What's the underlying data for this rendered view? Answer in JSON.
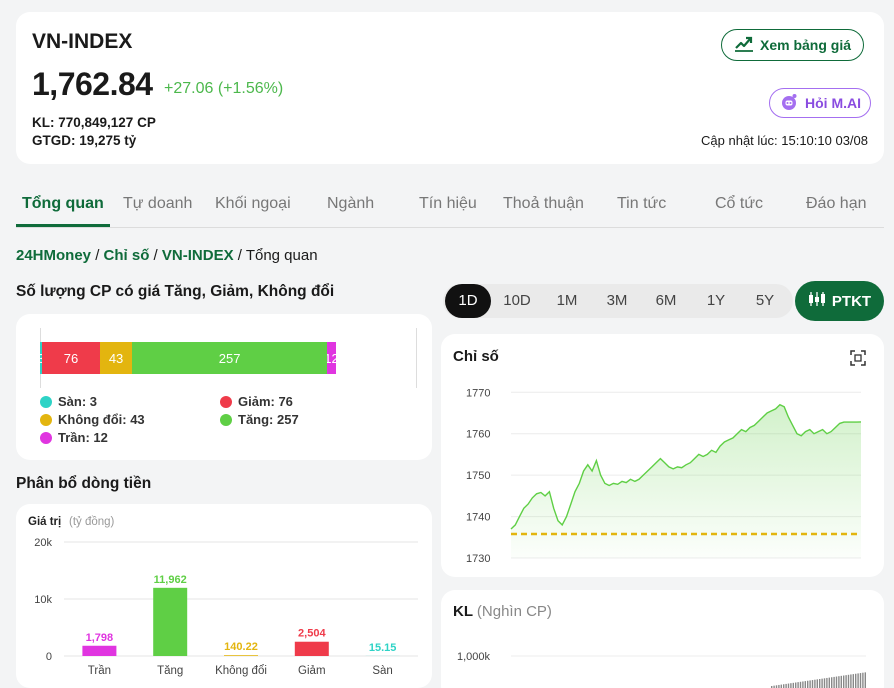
{
  "header": {
    "index_name": "VN-INDEX",
    "index_value": "1,762.84",
    "change": "+27.06 (+1.56%)",
    "volume_label": "KL: 770,849,127 CP",
    "value_label": "GTGD: 19,275 tỷ",
    "price_board_button": "Xem bảng giá",
    "ask_ai_button": "Hỏi M.AI",
    "update_text": "Cập nhật lúc: 15:10:10 03/08",
    "colors": {
      "up": "#4cb84c",
      "brand": "#0f6b3a",
      "ai": "#8a4ce0"
    }
  },
  "tabs": [
    "Tổng quan",
    "Tự doanh",
    "Khối ngoại",
    "Ngành",
    "Tín hiệu",
    "Thoả thuận",
    "Tin tức",
    "Cổ tức",
    "Đáo hạn"
  ],
  "breadcrumb": {
    "home": "24HMoney",
    "sep": " / ",
    "section": "Chỉ số",
    "index": "VN-INDEX",
    "current": "Tổng quan"
  },
  "breadth": {
    "title": "Số lượng CP có giá Tăng, Giảm, Không đổi",
    "segments": [
      {
        "key": "floor",
        "label": "3",
        "value": 3,
        "color": "#2ed3c6"
      },
      {
        "key": "down",
        "label": "76",
        "value": 76,
        "color": "#ef3b4a"
      },
      {
        "key": "flat",
        "label": "43",
        "value": 43,
        "color": "#e3b50f"
      },
      {
        "key": "up",
        "label": "257",
        "value": 257,
        "color": "#5fcf45"
      },
      {
        "key": "ceiling",
        "label": "12",
        "value": 12,
        "color": "#e035e0"
      }
    ],
    "legend": {
      "floor": "Sàn: 3",
      "down": "Giảm: 76",
      "flat": "Không đổi: 43",
      "up": "Tăng: 257",
      "ceiling": "Trần: 12"
    }
  },
  "money_flow": {
    "title": "Phân bổ dòng tiền",
    "chart_data": {
      "type": "bar",
      "ylabel": "Giá trị",
      "yunit": "(tỷ đồng)",
      "ylim": [
        0,
        20000
      ],
      "yticks": [
        "0",
        "10k",
        "20k"
      ],
      "yticks_values": [
        0,
        10000,
        20000
      ],
      "categories": [
        "Trần",
        "Tăng",
        "Không đổi",
        "Giảm",
        "Sàn"
      ],
      "values": [
        1798,
        11962,
        140.22,
        2504,
        15.15
      ],
      "value_labels": [
        "1,798",
        "11,962",
        "140.22",
        "2,504",
        "15.15"
      ],
      "colors": [
        "#e035e0",
        "#5fcf45",
        "#e3b50f",
        "#ef3b4a",
        "#2ed3c6"
      ]
    }
  },
  "ranges": [
    "1D",
    "10D",
    "1M",
    "3M",
    "6M",
    "1Y",
    "5Y"
  ],
  "active_range": "1D",
  "ptkt_button": "PTKT",
  "index_chart": {
    "title": "Chỉ số",
    "chart_data": {
      "type": "area",
      "ylim": [
        1730,
        1772
      ],
      "yticks": [
        1730,
        1740,
        1750,
        1760,
        1770
      ],
      "reference_value": 1735.78,
      "line_color": "#5fcf45",
      "ref_color": "#e3b50f",
      "values": [
        1737,
        1738,
        1740,
        1742,
        1743,
        1744.5,
        1745.5,
        1745.8,
        1745,
        1746,
        1742,
        1739,
        1738,
        1740,
        1743,
        1746,
        1748,
        1751,
        1752.5,
        1751,
        1753.5,
        1750,
        1748,
        1747.5,
        1748,
        1747.8,
        1748.5,
        1748.2,
        1749,
        1748.5,
        1749,
        1750,
        1751,
        1752,
        1753,
        1754,
        1753,
        1752,
        1751.5,
        1752,
        1751.8,
        1752.5,
        1753,
        1754,
        1755,
        1754.5,
        1755,
        1756,
        1755.5,
        1757,
        1758,
        1758.5,
        1759,
        1760,
        1761,
        1760.5,
        1761.5,
        1762,
        1763,
        1764,
        1765,
        1765.5,
        1766,
        1767,
        1766.5,
        1764,
        1762,
        1760,
        1759.5,
        1760.5,
        1761,
        1760,
        1760.5,
        1761,
        1760,
        1760.5,
        1761.5,
        1762.5,
        1762.8,
        1762.8,
        1762.8,
        1762.8,
        1762.84
      ]
    }
  },
  "volume_chart": {
    "title": "KL",
    "unit": "(Nghìn CP)",
    "chart_data": {
      "type": "bar",
      "yticks": [
        "1,000k"
      ]
    }
  }
}
